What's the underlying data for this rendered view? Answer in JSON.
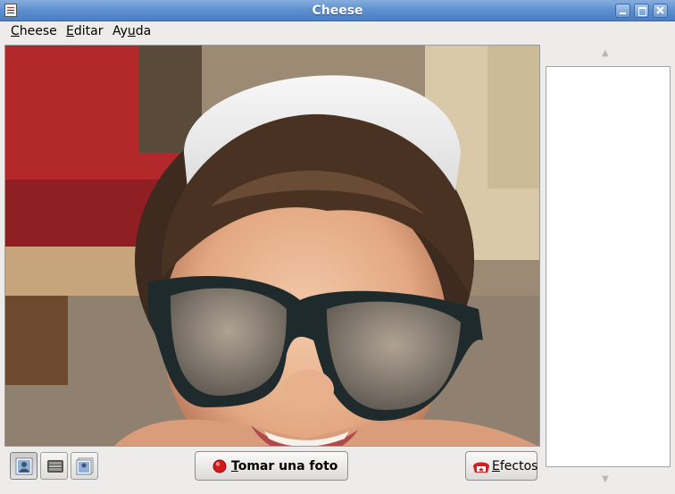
{
  "window": {
    "title": "Cheese",
    "controls": [
      "minimize-icon",
      "maximize-icon",
      "close-icon"
    ]
  },
  "menu": [
    {
      "label": "Cheese",
      "accel": "C"
    },
    {
      "label": "Editar",
      "accel": "E"
    },
    {
      "label": "Ayuda",
      "accel": "u"
    }
  ],
  "modes": [
    {
      "name": "photo-mode",
      "icon": "photo-icon",
      "active": true
    },
    {
      "name": "video-mode",
      "icon": "film-reel-icon",
      "active": false
    },
    {
      "name": "burst-mode",
      "icon": "photo-stack-icon",
      "active": false
    }
  ],
  "actions": {
    "take_photo": {
      "label": "Tomar una foto",
      "accel": "T",
      "icon": "record-dot-icon",
      "color": "#d51a1a"
    },
    "effects": {
      "label": "Efectos",
      "accel": "E",
      "icon": "effects-icon"
    }
  },
  "colors": {
    "titlebar": "#5d8fcf",
    "window_bg": "#edeceb"
  }
}
